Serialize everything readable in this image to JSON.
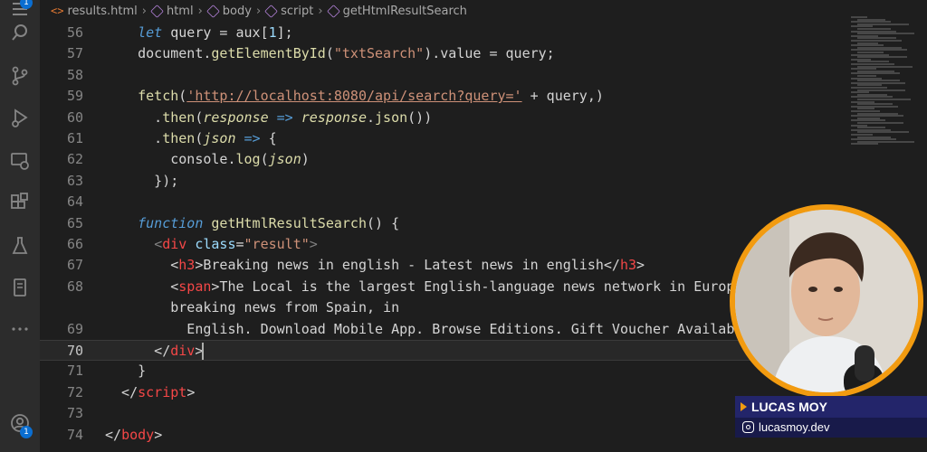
{
  "breadcrumb": {
    "file": "results.html",
    "items": [
      "html",
      "body",
      "script",
      "getHtmlResultSearch"
    ]
  },
  "activity_bar": {
    "icons": [
      "menu-icon",
      "files-icon",
      "search-icon",
      "source-control-icon",
      "run-debug-icon",
      "remote-explorer-icon",
      "extensions-icon",
      "testing-icon",
      "bookmark-icon",
      "more-icon",
      "account-icon"
    ],
    "badges": {
      "files": "1",
      "account": "1"
    }
  },
  "editor": {
    "current_line": "70",
    "lines": [
      {
        "n": "56",
        "tokens": [
          {
            "t": "    "
          },
          {
            "t": "let",
            "c": "kw"
          },
          {
            "t": " query = aux["
          },
          {
            "t": "1",
            "c": "attr"
          },
          {
            "t": "];"
          }
        ]
      },
      {
        "n": "57",
        "tokens": [
          {
            "t": "    document."
          },
          {
            "t": "getElementById",
            "c": "fn"
          },
          {
            "t": "("
          },
          {
            "t": "\"txtSearch\"",
            "c": "str"
          },
          {
            "t": ").value = query;"
          }
        ]
      },
      {
        "n": "58",
        "tokens": []
      },
      {
        "n": "59",
        "tokens": [
          {
            "t": "    "
          },
          {
            "t": "fetch",
            "c": "fn"
          },
          {
            "t": "("
          },
          {
            "t": "'http://localhost:8080/api/search?query='",
            "c": "url"
          },
          {
            "t": " + query,)"
          }
        ]
      },
      {
        "n": "60",
        "tokens": [
          {
            "t": "      ."
          },
          {
            "t": "then",
            "c": "fn"
          },
          {
            "t": "("
          },
          {
            "t": "response",
            "c": "ital"
          },
          {
            "t": " => ",
            "c": "kw"
          },
          {
            "t": "response",
            "c": "ital"
          },
          {
            "t": "."
          },
          {
            "t": "json",
            "c": "fn"
          },
          {
            "t": "())"
          }
        ]
      },
      {
        "n": "61",
        "tokens": [
          {
            "t": "      ."
          },
          {
            "t": "then",
            "c": "fn"
          },
          {
            "t": "("
          },
          {
            "t": "json",
            "c": "ital"
          },
          {
            "t": " => ",
            "c": "kw"
          },
          {
            "t": "{"
          }
        ]
      },
      {
        "n": "62",
        "tokens": [
          {
            "t": "        console."
          },
          {
            "t": "log",
            "c": "fn"
          },
          {
            "t": "("
          },
          {
            "t": "json",
            "c": "ital"
          },
          {
            "t": ")"
          }
        ]
      },
      {
        "n": "63",
        "tokens": [
          {
            "t": "      });"
          }
        ]
      },
      {
        "n": "64",
        "tokens": []
      },
      {
        "n": "65",
        "tokens": [
          {
            "t": "    "
          },
          {
            "t": "function",
            "c": "kw"
          },
          {
            "t": " "
          },
          {
            "t": "getHtmlResultSearch",
            "c": "fn"
          },
          {
            "t": "() {"
          }
        ]
      },
      {
        "n": "66",
        "tokens": [
          {
            "t": "      "
          },
          {
            "t": "<",
            "c": "punc"
          },
          {
            "t": "div",
            "c": "tagn"
          },
          {
            "t": " "
          },
          {
            "t": "class",
            "c": "attr"
          },
          {
            "t": "="
          },
          {
            "t": "\"result\"",
            "c": "str"
          },
          {
            "t": ">",
            "c": "punc"
          }
        ]
      },
      {
        "n": "67",
        "tokens": [
          {
            "t": "        <"
          },
          {
            "t": "h3",
            "c": "tagn"
          },
          {
            "t": ">Breaking news in english - Latest news in english</"
          },
          {
            "t": "h3",
            "c": "tagn"
          },
          {
            "t": ">"
          }
        ]
      },
      {
        "n": "68",
        "tokens": [
          {
            "t": "        <"
          },
          {
            "t": "span",
            "c": "tagn"
          },
          {
            "t": ">The Local is the largest English-language news network in Europe"
          }
        ]
      },
      {
        "n": "",
        "tokens": [
          {
            "t": "        breaking news from Spain, in"
          }
        ]
      },
      {
        "n": "69",
        "tokens": [
          {
            "t": "          English. Download Mobile App. Browse Editions. Gift Voucher Availab"
          }
        ]
      },
      {
        "n": "70",
        "tokens": [
          {
            "t": "      </"
          },
          {
            "t": "div",
            "c": "tagn"
          },
          {
            "t": ">"
          }
        ]
      },
      {
        "n": "71",
        "tokens": [
          {
            "t": "    }"
          }
        ]
      },
      {
        "n": "72",
        "tokens": [
          {
            "t": "  </"
          },
          {
            "t": "script",
            "c": "tagn"
          },
          {
            "t": ">"
          }
        ]
      },
      {
        "n": "73",
        "tokens": []
      },
      {
        "n": "74",
        "tokens": [
          {
            "t": "</"
          },
          {
            "t": "body",
            "c": "tagn"
          },
          {
            "t": ">"
          }
        ]
      }
    ]
  },
  "overlay": {
    "name": "LUCAS MOY",
    "handle": "lucasmoy.dev",
    "accent": "#f29b10",
    "name_bg": "#23256a"
  }
}
